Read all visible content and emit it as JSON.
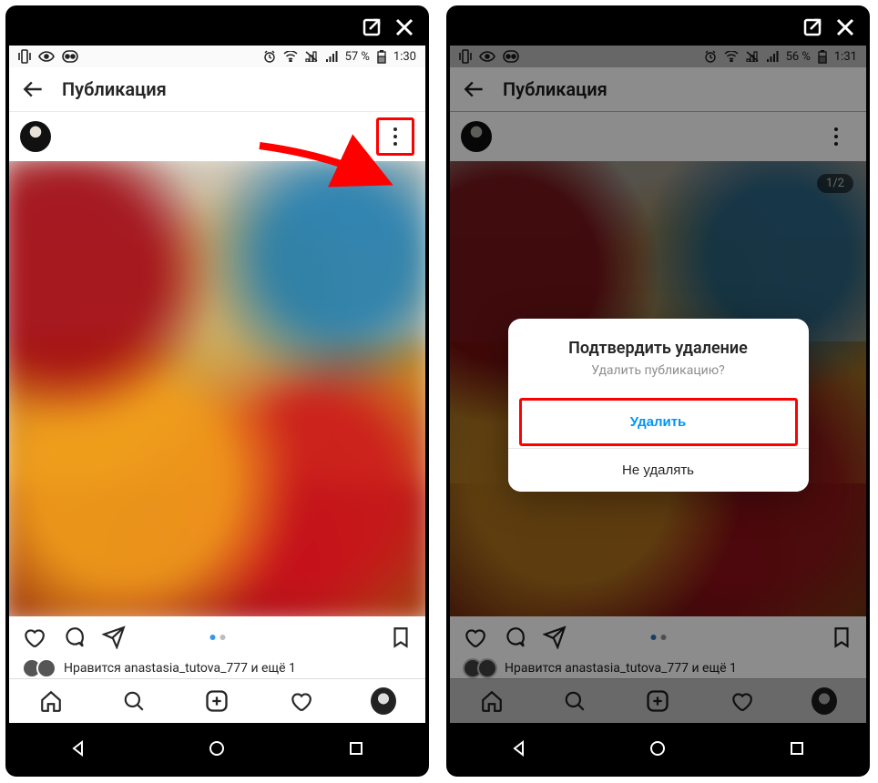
{
  "frame": {
    "open_icon": "open-external",
    "close_icon": "close"
  },
  "left": {
    "status": {
      "battery_pct": "57 %",
      "time": "1:30"
    },
    "header": {
      "title": "Публикация"
    },
    "post": {
      "more_highlighted": true,
      "pager": {
        "count": 2,
        "active": 0
      },
      "likes_text": "Нравится anastasia_tutova_777 и ещё 1"
    }
  },
  "right": {
    "status": {
      "battery_pct": "56 %",
      "time": "1:31"
    },
    "header": {
      "title": "Публикация"
    },
    "post": {
      "counter": "1/2",
      "pager": {
        "count": 2,
        "active": 0
      },
      "likes_text": "Нравится anastasia_tutova_777 и ещё 1"
    },
    "dialog": {
      "title": "Подтвердить удаление",
      "message": "Удалить публикацию?",
      "primary": "Удалить",
      "secondary": "Не удалять"
    }
  },
  "icons": {
    "back": "arrow-left",
    "heart": "heart",
    "comment": "comment",
    "share": "paper-plane",
    "bookmark": "bookmark",
    "home": "home",
    "search": "search",
    "add": "add-square",
    "activity": "heart",
    "alarm": "alarm",
    "wifi": "wifi",
    "nosignal": "signal-off",
    "cell": "cell",
    "battery": "battery",
    "vibr": "vibrate",
    "eye": "eye",
    "dual": "dual-tab"
  }
}
